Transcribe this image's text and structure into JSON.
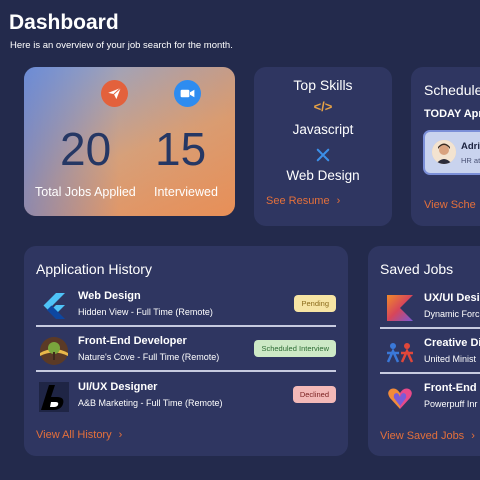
{
  "header": {
    "title": "Dashboard",
    "subtitle": "Here is an overview of your job search for the month."
  },
  "stats": {
    "applied_count": "20",
    "applied_label": "Total Jobs Applied",
    "interviewed_count": "15",
    "interviewed_label": "Interviewed",
    "applied_icon": "paper-plane-icon",
    "interviewed_icon": "video-camera-icon"
  },
  "skills": {
    "title": "Top Skills",
    "items": [
      {
        "label": "Javascript",
        "icon": "code-icon"
      },
      {
        "label": "Web Design",
        "icon": "design-tools-icon"
      }
    ],
    "link_label": "See Resume",
    "link_arrow": "›"
  },
  "schedule": {
    "title": "Schedule",
    "today_label": "TODAY Apr",
    "item": {
      "name": "Adri",
      "role": "HR at"
    },
    "link_label": "View Sche"
  },
  "history": {
    "title": "Application History",
    "rows": [
      {
        "title": "Web Design",
        "subtitle": "Hidden View - Full Time (Remote)",
        "status": "Pending",
        "logo": "flutter-logo"
      },
      {
        "title": "Front-End Developer",
        "subtitle": "Nature's Cove - Full Time (Remote)",
        "status": "Scheduled Interview",
        "logo": "natures-cove-logo"
      },
      {
        "title": "UI/UX Designer",
        "subtitle": "A&B Marketing - Full Time (Remote)",
        "status": "Declined",
        "logo": "ab-marketing-logo"
      }
    ],
    "link_label": "View All History",
    "link_arrow": "›"
  },
  "saved": {
    "title": "Saved Jobs",
    "rows": [
      {
        "title": "UX/UI Design",
        "subtitle": "Dynamic Forc",
        "logo": "kotlin-logo"
      },
      {
        "title": "Creative Dir",
        "subtitle": "United Minist",
        "logo": "people-logo"
      },
      {
        "title": "Front-End D",
        "subtitle": "Powerpuff Inr",
        "logo": "hearts-logo"
      }
    ],
    "link_label": "View Saved Jobs",
    "link_arrow": "›"
  },
  "colors": {
    "background": "#232a4c",
    "card": "#2f3661",
    "accent": "#e4703b",
    "stat_number": "#253764"
  }
}
